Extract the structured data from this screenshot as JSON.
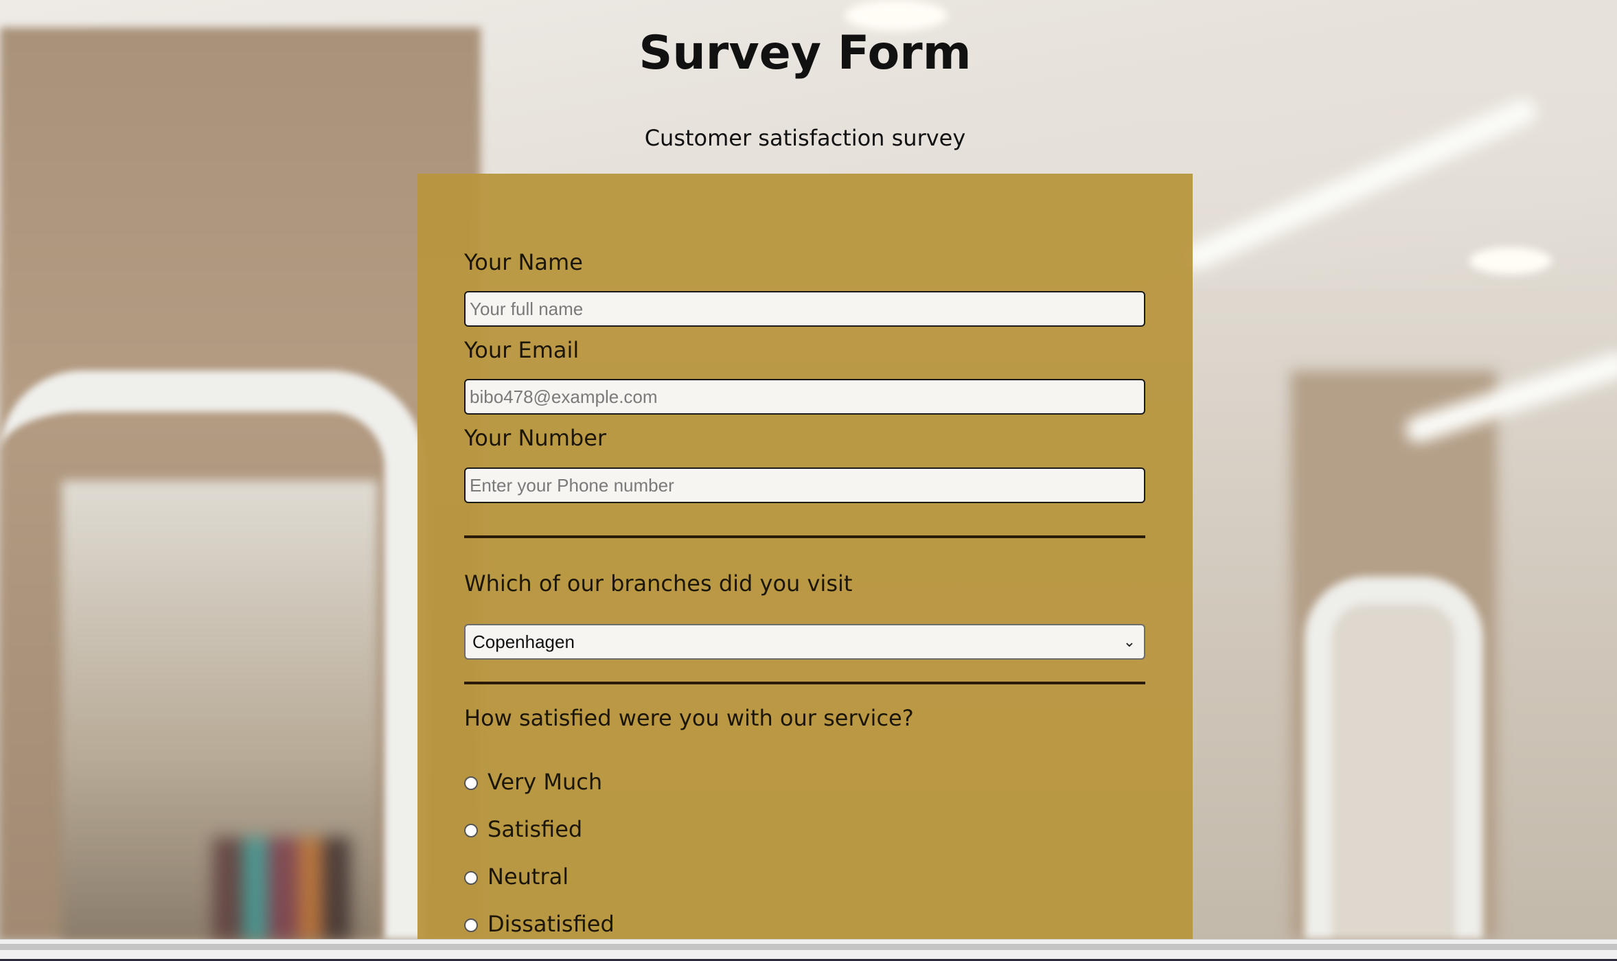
{
  "header": {
    "title": "Survey Form",
    "subtitle": "Customer satisfaction survey"
  },
  "form": {
    "name": {
      "label": "Your Name",
      "placeholder": "Your full name",
      "value": ""
    },
    "email": {
      "label": "Your Email",
      "placeholder": "bibo478@example.com",
      "value": ""
    },
    "number": {
      "label": "Your Number",
      "placeholder": "Enter your Phone number",
      "value": ""
    },
    "branch": {
      "question": "Which of our branches did you visit",
      "selected": "Copenhagen"
    },
    "satisfaction": {
      "question": "How satisfied were you with our service?",
      "options": [
        "Very Much",
        "Satisfied",
        "Neutral",
        "Dissatisfied"
      ],
      "selected": null
    }
  },
  "icons": {
    "select_chevron": "chevron-down-icon"
  },
  "colors": {
    "card_background": "#b8963e",
    "text": "#1b1608",
    "divider": "#2a1a08"
  }
}
